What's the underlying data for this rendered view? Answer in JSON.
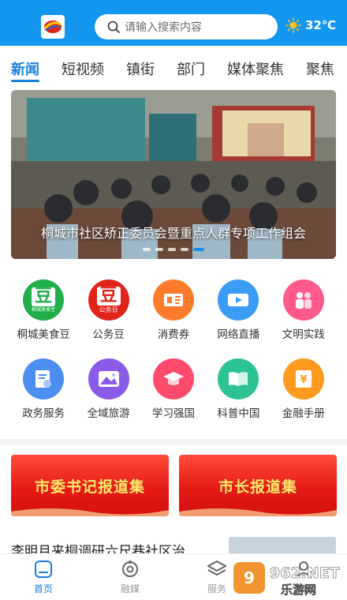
{
  "header": {
    "search_placeholder": "请输入搜索内容",
    "weather": "32℃"
  },
  "tabs": [
    {
      "label": "新闻",
      "active": true
    },
    {
      "label": "短视频"
    },
    {
      "label": "镇街"
    },
    {
      "label": "部门"
    },
    {
      "label": "媒体聚焦"
    },
    {
      "label": "聚焦"
    }
  ],
  "banner": {
    "caption": "桐城市社区矫正委员会暨重点人群专项工作组会",
    "active_slide": 4,
    "slide_count": 5
  },
  "services": [
    {
      "label": "桐城美食豆",
      "icon": "bean-icon",
      "badge": "豆",
      "sub": "桐城美食豆",
      "color": "#1fae4a"
    },
    {
      "label": "公务豆",
      "icon": "bean-icon",
      "badge": "豆",
      "sub": "公务日",
      "color": "#e2231a"
    },
    {
      "label": "消费券",
      "icon": "coupon-icon",
      "color": "#ff7a2a"
    },
    {
      "label": "网络直播",
      "icon": "video-icon",
      "color": "#3b9cf5"
    },
    {
      "label": "文明实践",
      "icon": "people-icon",
      "color": "#ff5b8a"
    },
    {
      "label": "政务服务",
      "icon": "document-icon",
      "color": "#4b8ef0"
    },
    {
      "label": "全域旅游",
      "icon": "landscape-icon",
      "color": "#8a5ae8"
    },
    {
      "label": "学习强国",
      "icon": "graduation-cap-icon",
      "color": "#ff4b6b"
    },
    {
      "label": "科普中国",
      "icon": "book-icon",
      "color": "#2cc293"
    },
    {
      "label": "金融手册",
      "icon": "finance-icon",
      "color": "#ff9a1f"
    }
  ],
  "cards": [
    {
      "label": "市委书记报道集"
    },
    {
      "label": "市长报道集"
    }
  ],
  "news": {
    "title": "李明月来桐调研六尺巷社区治"
  },
  "bottom_nav": [
    {
      "label": "首页",
      "icon": "home-icon",
      "active": true
    },
    {
      "label": "融媒",
      "icon": "media-icon"
    },
    {
      "label": "服务",
      "icon": "layers-icon"
    },
    {
      "label": "我的",
      "icon": "user-icon"
    }
  ],
  "watermark": {
    "brand": "962.NET",
    "sub": "乐游网"
  },
  "colors": {
    "header": "#1296f0",
    "accent": "#1a7ee0",
    "card_red": "#e51a15",
    "card_text": "#ffe96b"
  }
}
